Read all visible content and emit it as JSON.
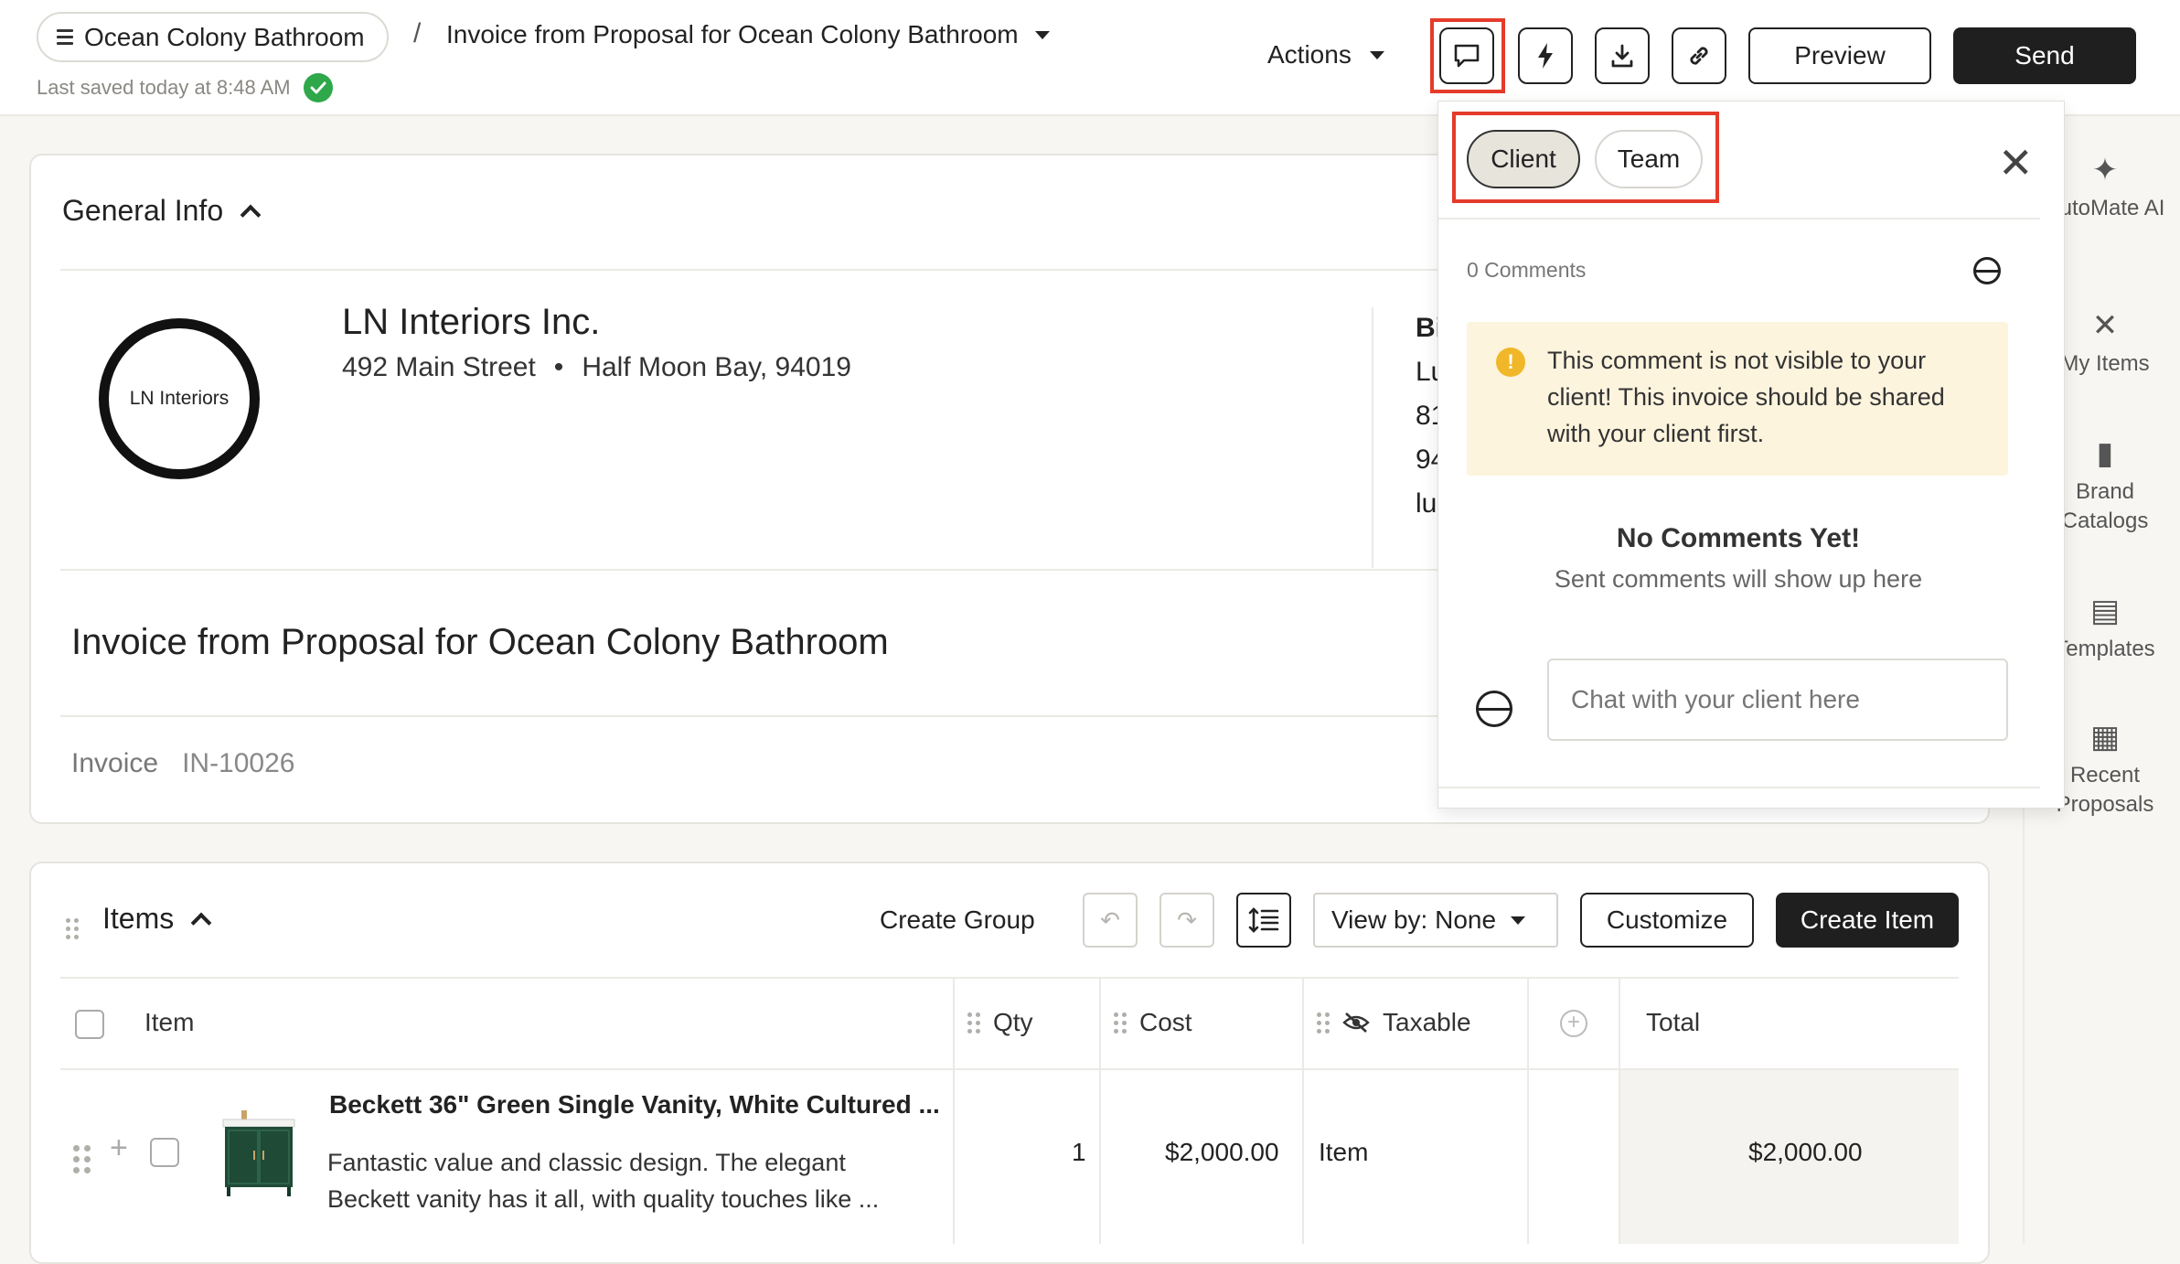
{
  "header": {
    "project_name": "Ocean Colony Bathroom",
    "separator": "/",
    "document_title": "Invoice from Proposal for Ocean Colony Bathroom",
    "saved_status": "Last saved today at 8:48 AM",
    "actions_label": "Actions",
    "preview_label": "Preview",
    "send_label": "Send",
    "icon_buttons": [
      "comment-icon",
      "lightning-icon",
      "download-icon",
      "link-icon"
    ]
  },
  "general_info": {
    "section_title": "General Info",
    "logo_text": "LN Interiors",
    "company_name": "LN Interiors Inc.",
    "street": "492 Main Street",
    "address_sep": "•",
    "city": "Half Moon Bay, 94019",
    "bill_to_fragments": [
      "Bi",
      "Lu",
      "81",
      "94",
      "lu"
    ],
    "invoice_title": "Invoice from Proposal for Ocean Colony Bathroom",
    "invoice_label": "Invoice",
    "invoice_number": "IN-10026"
  },
  "items": {
    "section_title": "Items",
    "create_group": "Create Group",
    "view_by": "View by: None",
    "customize": "Customize",
    "create_item": "Create Item",
    "columns": {
      "item": "Item",
      "qty": "Qty",
      "cost": "Cost",
      "taxable": "Taxable",
      "total": "Total"
    },
    "rows": [
      {
        "name": "Beckett 36\" Green Single Vanity, White Cultured ...",
        "description_line1": "Fantastic value and classic design. The elegant",
        "description_line2": "Beckett vanity has it all, with quality touches like ...",
        "qty": "1",
        "cost": "$2,000.00",
        "taxable": "Item",
        "total": "$2,000.00"
      }
    ]
  },
  "comments_panel": {
    "tabs": [
      {
        "label": "Client",
        "active": true
      },
      {
        "label": "Team",
        "active": false
      }
    ],
    "count_label": "0 Comments",
    "warning": "This comment is not visible to your client! This invoice should be shared with your client first.",
    "empty_title": "No Comments Yet!",
    "empty_subtitle": "Sent comments will show up here",
    "input_placeholder": "Chat with your client here"
  },
  "right_rail": [
    {
      "label": "AutoMate AI",
      "icon": "sparkle-icon"
    },
    {
      "label": "My Items",
      "icon": "tools-icon"
    },
    {
      "label": "Brand Catalogs",
      "icon": "book-icon"
    },
    {
      "label": "Templates",
      "icon": "document-icon"
    },
    {
      "label": "Recent Proposals",
      "icon": "calculator-icon"
    }
  ],
  "colors": {
    "highlight": "#e53b2a",
    "primary_dark": "#1f1f1f",
    "success": "#2ea84a",
    "warning_bg": "#fdf4de",
    "warning_icon": "#f0b729"
  }
}
